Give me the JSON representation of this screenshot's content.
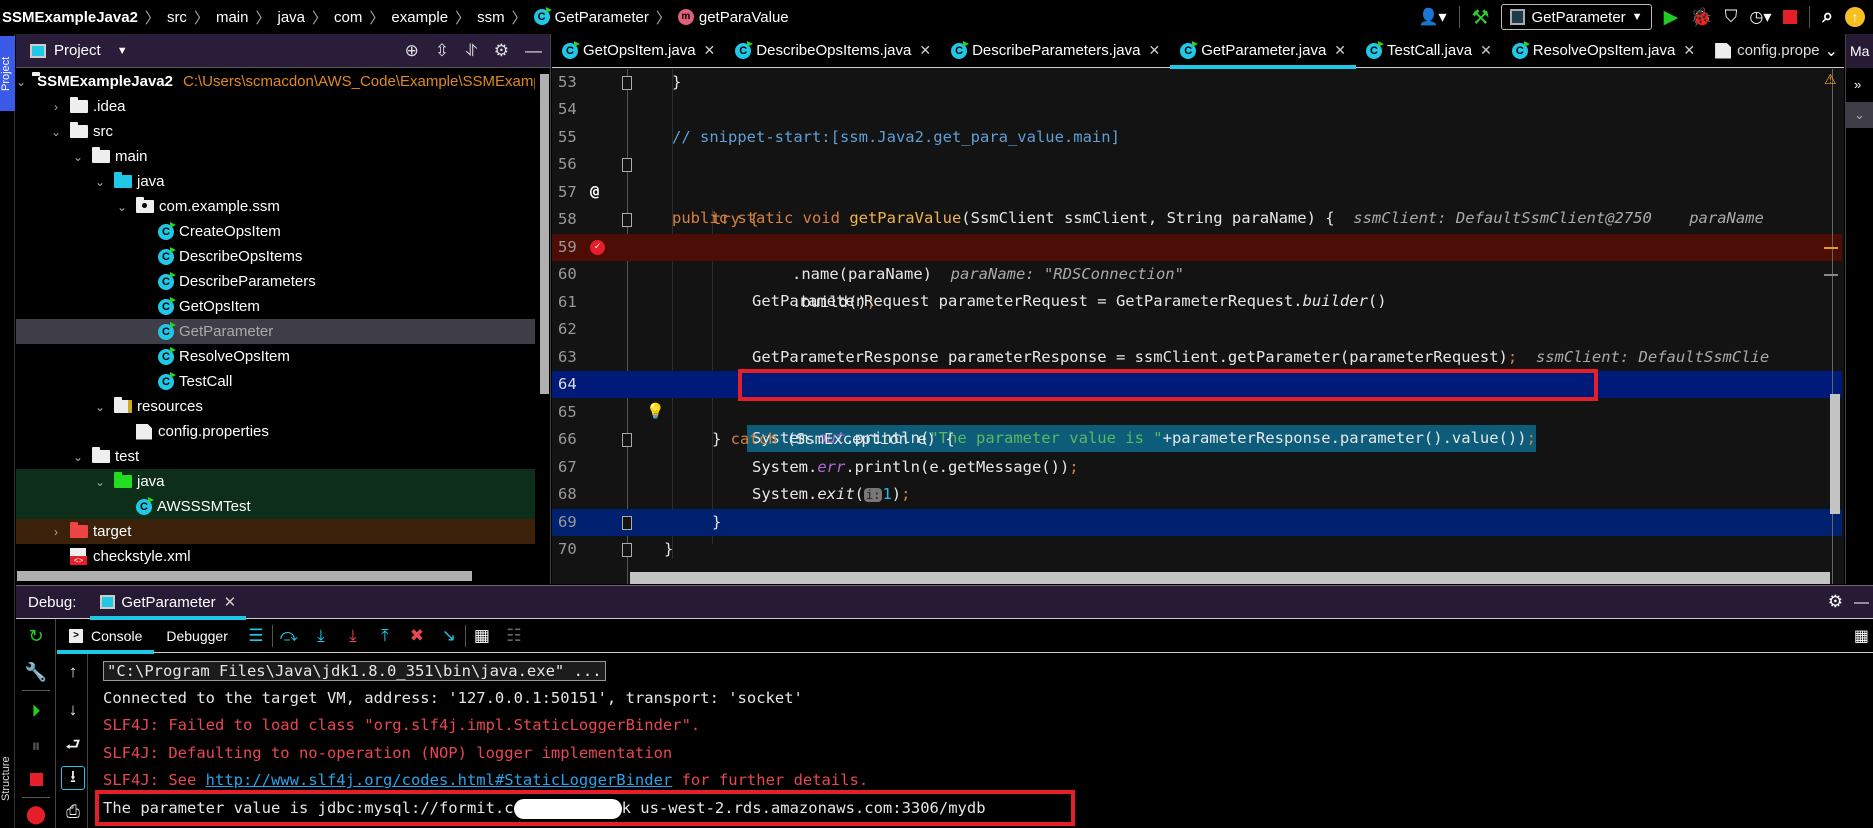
{
  "navbar": {
    "breadcrumbs": [
      "SSMExampleJava2",
      "src",
      "main",
      "java",
      "com",
      "example",
      "ssm",
      "GetParameter",
      "getParaValue"
    ],
    "run_config": "GetParameter",
    "icons": [
      "user-icon",
      "build-hammer-icon",
      "run-icon",
      "debug-icon",
      "coverage-icon",
      "profile-icon",
      "stop-icon",
      "search-icon",
      "update-icon"
    ]
  },
  "left_stripe": {
    "project_tab": "Project",
    "structure_tab": "Structure"
  },
  "project_panel": {
    "title": "Project",
    "tree": [
      {
        "label": "SSMExampleJava2",
        "path": "C:\\Users\\scmacdon\\AWS_Code\\Example\\SSMExample",
        "type": "module",
        "expanded": true
      },
      {
        "label": ".idea",
        "type": "folder",
        "expanded": false
      },
      {
        "label": "src",
        "type": "folder",
        "expanded": true
      },
      {
        "label": "main",
        "type": "folder",
        "expanded": true
      },
      {
        "label": "java",
        "type": "source-folder",
        "expanded": true
      },
      {
        "label": "com.example.ssm",
        "type": "package",
        "expanded": true
      },
      {
        "label": "CreateOpsItem",
        "type": "class"
      },
      {
        "label": "DescribeOpsItems",
        "type": "class"
      },
      {
        "label": "DescribeParameters",
        "type": "class"
      },
      {
        "label": "GetOpsItem",
        "type": "class"
      },
      {
        "label": "GetParameter",
        "type": "class",
        "selected": true
      },
      {
        "label": "ResolveOpsItem",
        "type": "class"
      },
      {
        "label": "TestCall",
        "type": "class"
      },
      {
        "label": "resources",
        "type": "resources-folder",
        "expanded": true
      },
      {
        "label": "config.properties",
        "type": "properties"
      },
      {
        "label": "test",
        "type": "folder",
        "expanded": true
      },
      {
        "label": "java",
        "type": "test-folder",
        "expanded": true
      },
      {
        "label": "AWSSSMTest",
        "type": "test-class"
      },
      {
        "label": "target",
        "type": "excluded-folder",
        "expanded": false
      },
      {
        "label": "checkstyle.xml",
        "type": "xml"
      }
    ]
  },
  "editor": {
    "tabs": [
      {
        "label": "GetOpsItem.java",
        "active": false
      },
      {
        "label": "DescribeOpsItems.java",
        "active": false
      },
      {
        "label": "DescribeParameters.java",
        "active": false
      },
      {
        "label": "GetParameter.java",
        "active": true
      },
      {
        "label": "TestCall.java",
        "active": false
      },
      {
        "label": "ResolveOpsItem.java",
        "active": false
      },
      {
        "label": "config.prope",
        "active": false
      }
    ],
    "lines": {
      "53": "}",
      "55": "// snippet-start:[ssm.Java2.get_para_value.main]",
      "56_kw": "public static void ",
      "56_fn": "getParaValue",
      "56_rest": "(SsmClient ssmClient, String paraName) {",
      "56_hint": "ssmClient: DefaultSsmClient@2750    paraName",
      "58": "try {",
      "59_a": "GetParameterRequest parameterRequest = GetParameterRequest.",
      "59_b": "builder",
      "59_c": "()",
      "60": ".name(paraName)",
      "60_hint": "paraName: \"RDSConnection\"",
      "61": ".build()",
      "63": "GetParameterResponse parameterResponse = ssmClient.getParameter(parameterRequest)",
      "63_hint": "ssmClient: DefaultSsmClie",
      "64_a": "System.",
      "64_b": "out",
      "64_c": ".println(",
      "64_str": "\"The parameter value is \"",
      "64_d": "+parameterResponse.parameter().value())",
      "66_a": "} ",
      "66_kw": "catch",
      "66_b": " (SsmException e) {",
      "67_a": "System.",
      "67_b": "err",
      "67_c": ".println(e.getMessage())",
      "68_a": "System.",
      "68_b": "exit",
      "68_c": "(",
      "68_param": "i:",
      "68_num": "1",
      "68_d": ")",
      "69": "}",
      "70": "}"
    },
    "line_numbers": [
      "53",
      "54",
      "55",
      "56",
      "57",
      "58",
      "59",
      "60",
      "61",
      "62",
      "63",
      "64",
      "65",
      "66",
      "67",
      "68",
      "69",
      "70"
    ]
  },
  "right_stripe": {
    "label": "Ma"
  },
  "debug": {
    "label": "Debug:",
    "session_tab": "GetParameter",
    "tabs": [
      {
        "label": "Console",
        "active": true
      },
      {
        "label": "Debugger",
        "active": false
      }
    ],
    "console": [
      {
        "text": "\"C:\\Program Files\\Java\\jdk1.8.0_351\\bin\\java.exe\" ...",
        "kind": "cmd"
      },
      {
        "text": "Connected to the target VM, address: '127.0.0.1:50151', transport: 'socket'",
        "kind": "info"
      },
      {
        "text": "SLF4J: Failed to load class \"org.slf4j.impl.StaticLoggerBinder\".",
        "kind": "error"
      },
      {
        "text": "SLF4J: Defaulting to no-operation (NOP) logger implementation",
        "kind": "error"
      },
      {
        "prefix": "SLF4J: See ",
        "link": "http://www.slf4j.org/codes.html#StaticLoggerBinder",
        "suffix": " for further details.",
        "kind": "error-link"
      },
      {
        "prefix": "The parameter value is jdbc:mysql://formit.c",
        "suffix": "k us-west-2.rds.amazonaws.com:3306/mydb",
        "kind": "output-redacted"
      }
    ]
  },
  "colors": {
    "accent": "#20c8e8",
    "highlight_box": "#e41f29",
    "breakpoint_line": "#4b0d05",
    "current_line": "#001a7a",
    "panel_header": "#2a1d3a"
  }
}
